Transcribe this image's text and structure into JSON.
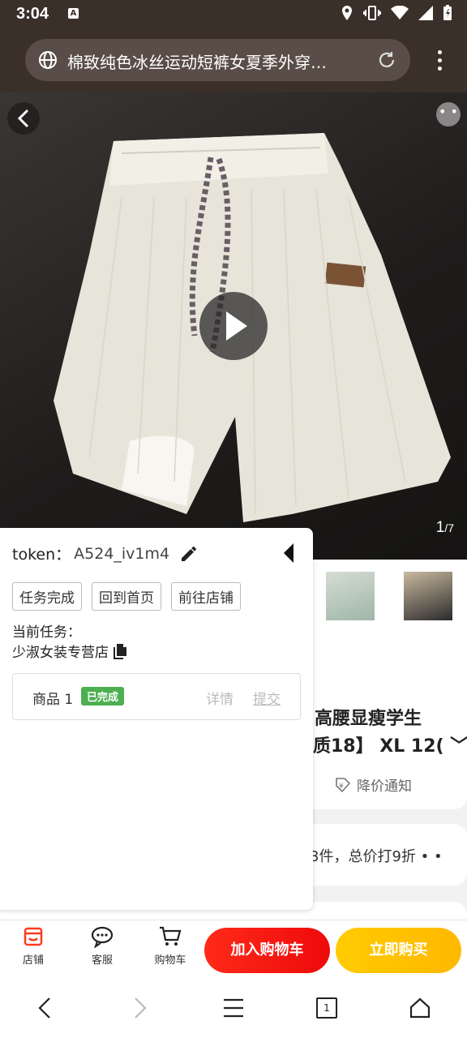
{
  "status_bar": {
    "time": "3:04",
    "notification_icon": "A"
  },
  "browser": {
    "url_title": "棉致纯色冰丝运动短裤女夏季外穿…"
  },
  "gallery": {
    "current": "1",
    "total": "/7"
  },
  "panel": {
    "token_label": "token：",
    "token_value": "A524_iv1m4",
    "buttons": [
      "任务完成",
      "回到首页",
      "前往店铺"
    ],
    "current_task_label": "当前任务：",
    "store_name": "少淑女装专营店",
    "item": {
      "name": "商品 1",
      "status": "已完成",
      "detail": "详情",
      "submit": "提交"
    }
  },
  "product": {
    "title_fragment_1": "高腰显瘦学生",
    "title_fragment_2": "质18】 XL 12(",
    "price_alert": "降价通知",
    "promo_fragment": "3件，总价打9折"
  },
  "action_bar": {
    "store": "店铺",
    "service": "客服",
    "cart": "购物车",
    "add_to_cart": "加入购物车",
    "buy_now": "立即购买"
  },
  "nav": {
    "tab_count": "1"
  },
  "colors": {
    "status_bg": "#3b2f2a",
    "cart_red": "#ff2a1a",
    "buy_yellow": "#ffc000",
    "badge_green": "#4caf50"
  }
}
